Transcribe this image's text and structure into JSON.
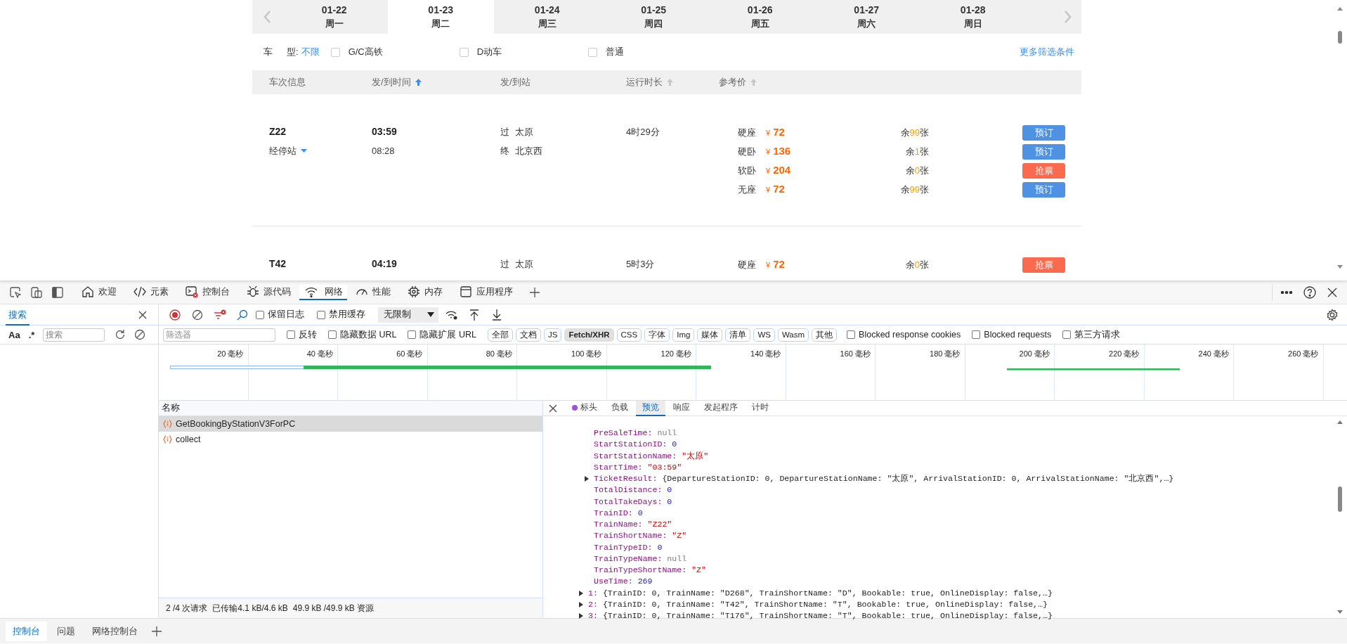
{
  "booking": {
    "dates": [
      {
        "date": "01-22",
        "weekday": "周一",
        "selected": false
      },
      {
        "date": "01-23",
        "weekday": "周二",
        "selected": true
      },
      {
        "date": "01-24",
        "weekday": "周三",
        "selected": false
      },
      {
        "date": "01-25",
        "weekday": "周四",
        "selected": false
      },
      {
        "date": "01-26",
        "weekday": "周五",
        "selected": false
      },
      {
        "date": "01-27",
        "weekday": "周六",
        "selected": false
      },
      {
        "date": "01-28",
        "weekday": "周日",
        "selected": false
      }
    ],
    "filter": {
      "label": [
        "车",
        "型:"
      ],
      "value": "不限",
      "options": [
        {
          "label": "G/C高铁",
          "checked": false
        },
        {
          "label": "D动车",
          "checked": false
        },
        {
          "label": "普通",
          "checked": false
        }
      ],
      "more": "更多筛选条件"
    },
    "columns": [
      {
        "label": "车次信息",
        "kind": "plain"
      },
      {
        "label": "发/到时间",
        "kind": "sorted"
      },
      {
        "label": "发/到站",
        "kind": "plain"
      },
      {
        "label": "运行时长",
        "kind": "sortable"
      },
      {
        "label": "参考价",
        "kind": "sortable"
      }
    ],
    "trains": [
      {
        "number": "Z22",
        "stops": "经停站",
        "depart": "03:59",
        "arrive": "08:28",
        "from_mark": "过",
        "from": "太原",
        "to_mark": "终",
        "to": "北京西",
        "duration": "4时29分",
        "seats": [
          {
            "type": "硬座",
            "currency": "¥",
            "price": "72",
            "prefix": "余",
            "count": "99",
            "suffix": "张",
            "kind": "book",
            "button": "预订"
          },
          {
            "type": "硬卧",
            "currency": "¥",
            "price": "136",
            "prefix": "余",
            "count": "1",
            "suffix": "张",
            "kind": "book",
            "button": "预订"
          },
          {
            "type": "软卧",
            "currency": "¥",
            "price": "204",
            "prefix": "余",
            "count": "0",
            "suffix": "张",
            "kind": "grab",
            "button": "抢票"
          },
          {
            "type": "无座",
            "currency": "¥",
            "price": "72",
            "prefix": "余",
            "count": "99",
            "suffix": "张",
            "kind": "book",
            "button": "预订"
          }
        ]
      },
      {
        "number": "T42",
        "depart": "04:19",
        "from_mark": "过",
        "from": "太原",
        "duration": "5时3分",
        "seats": [
          {
            "type": "硬座",
            "currency": "¥",
            "price": "72",
            "prefix": "余",
            "count": "0",
            "suffix": "张",
            "kind": "grab",
            "button": "抢票"
          }
        ]
      }
    ]
  },
  "devtools": {
    "tabs": [
      {
        "label": "欢迎",
        "selected": false
      },
      {
        "label": "元素",
        "selected": false
      },
      {
        "label": "控制台",
        "selected": false
      },
      {
        "label": "源代码",
        "selected": false
      },
      {
        "label": "网络",
        "selected": true
      },
      {
        "label": "性能",
        "selected": false
      },
      {
        "label": "内存",
        "selected": false
      },
      {
        "label": "应用程序",
        "selected": false
      }
    ],
    "search_panel": {
      "tab": "搜索",
      "case": "Aa",
      "regex": ".*",
      "placeholder": "搜索"
    },
    "toolbar": {
      "checkboxes": [
        {
          "label": "保留日志",
          "checked": false
        },
        {
          "label": "禁用缓存",
          "checked": false
        }
      ],
      "throttle": "无限制"
    },
    "filter": {
      "placeholder": "筛选器",
      "checkboxes": [
        {
          "label": "反转",
          "checked": false
        },
        {
          "label": "隐藏数据 URL",
          "checked": false
        },
        {
          "label": "隐藏扩展 URL",
          "checked": false
        }
      ],
      "types": [
        {
          "label": "全部",
          "selected": false
        },
        {
          "label": "文档",
          "selected": false
        },
        {
          "label": "JS",
          "selected": false
        },
        {
          "label": "Fetch/XHR",
          "selected": true
        },
        {
          "label": "CSS",
          "selected": false
        },
        {
          "label": "字体",
          "selected": false
        },
        {
          "label": "Img",
          "selected": false
        },
        {
          "label": "媒体",
          "selected": false
        },
        {
          "label": "清单",
          "selected": false
        },
        {
          "label": "WS",
          "selected": false
        },
        {
          "label": "Wasm",
          "selected": false
        },
        {
          "label": "其他",
          "selected": false
        }
      ],
      "more_checkboxes": [
        {
          "label": "Blocked response cookies",
          "checked": false
        },
        {
          "label": "Blocked requests",
          "checked": false
        },
        {
          "label": "第三方请求",
          "checked": false
        }
      ]
    },
    "timeline": {
      "ticks": [
        "20 毫秒",
        "40 毫秒",
        "60 毫秒",
        "80 毫秒",
        "100 毫秒",
        "120 毫秒",
        "140 毫秒",
        "160 毫秒",
        "180 毫秒",
        "200 毫秒",
        "220 毫秒",
        "240 毫秒",
        "260 毫秒"
      ]
    },
    "requests": {
      "column": "名称",
      "rows": [
        {
          "name": "GetBookingByStationV3ForPC",
          "selected": true
        },
        {
          "name": "collect",
          "selected": false
        }
      ],
      "summary": [
        "2 /4 次请求",
        "已传输4.1 kB/4.6 kB",
        "49.9 kB /49.9 kB 资源"
      ]
    },
    "details": {
      "tabs": [
        {
          "label": "标头",
          "selected": false
        },
        {
          "label": "负载",
          "selected": false
        },
        {
          "label": "预览",
          "selected": true
        },
        {
          "label": "响应",
          "selected": false
        },
        {
          "label": "发起程序",
          "selected": false
        },
        {
          "label": "计时",
          "selected": false
        }
      ],
      "lines": [
        {
          "key": "PreSaleTime:",
          "value": "null",
          "kind": "null"
        },
        {
          "key": "StartStationID:",
          "value": "0",
          "kind": "number"
        },
        {
          "key": "StartStationName:",
          "value": "\"太原\"",
          "kind": "string"
        },
        {
          "key": "StartTime:",
          "value": "\"03:59\"",
          "kind": "string"
        },
        {
          "key": "TicketResult:",
          "value": "{DepartureStationID: 0, DepartureStationName: \"太原\", ArrivalStationID: 0, ArrivalStationName: \"北京西\",…}",
          "kind": "object",
          "expanded": false
        },
        {
          "key": "TotalDistance:",
          "value": "0",
          "kind": "number"
        },
        {
          "key": "TotalTakeDays:",
          "value": "0",
          "kind": "number"
        },
        {
          "key": "TrainID:",
          "value": "0",
          "kind": "number"
        },
        {
          "key": "TrainName:",
          "value": "\"Z22\"",
          "kind": "string"
        },
        {
          "key": "TrainShortName:",
          "value": "\"Z\"",
          "kind": "string"
        },
        {
          "key": "TrainTypeID:",
          "value": "0",
          "kind": "number"
        },
        {
          "key": "TrainTypeName:",
          "value": "null",
          "kind": "null"
        },
        {
          "key": "TrainTypeShortName:",
          "value": "\"Z\"",
          "kind": "string"
        },
        {
          "key": "UseTime:",
          "value": "269",
          "kind": "number"
        }
      ],
      "items": [
        {
          "key": "1:",
          "value": "{TrainID: 0, TrainName: \"D268\", TrainShortName: \"D\", Bookable: true, OnlineDisplay: false,…}",
          "expanded": false
        },
        {
          "key": "2:",
          "value": "{TrainID: 0, TrainName: \"T42\", TrainShortName: \"T\", Bookable: true, OnlineDisplay: false,…}",
          "expanded": false
        },
        {
          "key": "3:",
          "value": "{TrainID: 0, TrainName: \"T176\", TrainShortName: \"T\", Bookable: true, OnlineDisplay: false,…}",
          "expanded": false
        }
      ]
    },
    "drawer": {
      "tabs": [
        {
          "label": "控制台",
          "selected": true
        },
        {
          "label": "问题",
          "selected": false
        },
        {
          "label": "网络控制台",
          "selected": false
        }
      ]
    }
  }
}
